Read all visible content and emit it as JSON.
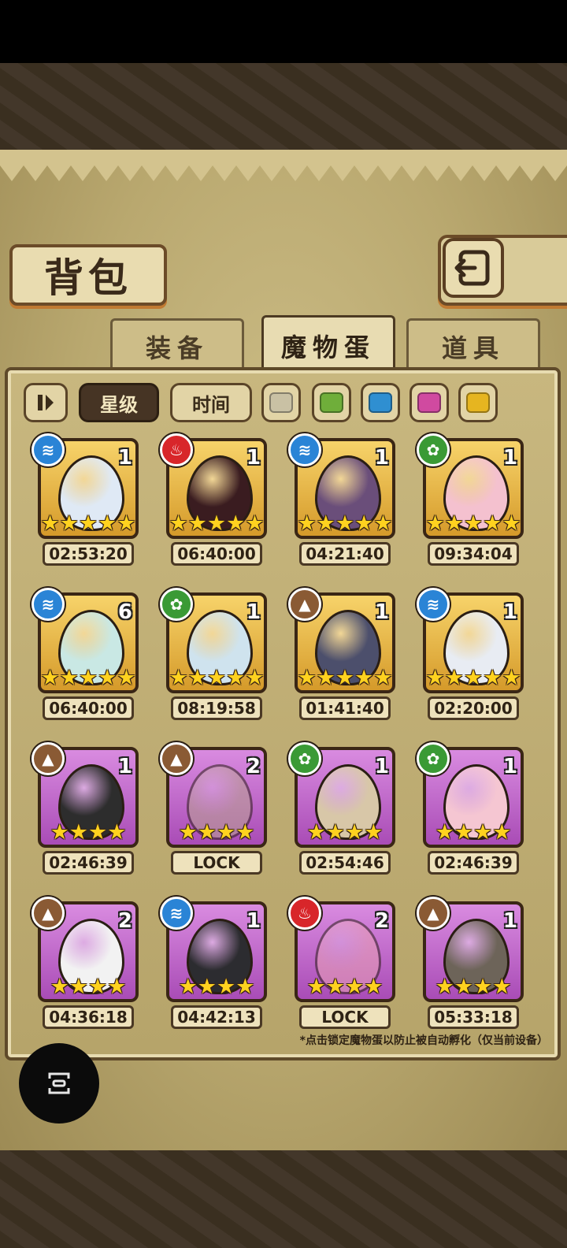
{
  "header": {
    "title": "背包"
  },
  "tabs": [
    {
      "label": "装备",
      "active": false
    },
    {
      "label": "魔物蛋",
      "active": true
    },
    {
      "label": "道具",
      "active": false
    }
  ],
  "filters": {
    "sort_icon": "sort-toggle-icon",
    "buttons": [
      {
        "label": "星级",
        "active": true
      },
      {
        "label": "时间",
        "active": false
      }
    ],
    "element_colors": [
      "#c9c1a4",
      "#6fae3a",
      "#2f8fd1",
      "#d04aa0",
      "#e6b520"
    ]
  },
  "elements": {
    "water": {
      "color": "#2a84d6",
      "glyph": "≋"
    },
    "fire": {
      "color": "#d8262a",
      "glyph": "♨"
    },
    "grass": {
      "color": "#3a9a35",
      "glyph": "✿"
    },
    "earth": {
      "color": "#8a5a34",
      "glyph": "▲"
    }
  },
  "eggs": [
    {
      "element": "water",
      "count": "1",
      "stars": 5,
      "rarity": "gold",
      "timer": "02:53:20",
      "egg_color": "#dfe9f5"
    },
    {
      "element": "fire",
      "count": "1",
      "stars": 5,
      "rarity": "gold",
      "timer": "06:40:00",
      "egg_color": "#3a1c20"
    },
    {
      "element": "water",
      "count": "1",
      "stars": 5,
      "rarity": "gold",
      "timer": "04:21:40",
      "egg_color": "#6a4e7a"
    },
    {
      "element": "grass",
      "count": "1",
      "stars": 5,
      "rarity": "gold",
      "timer": "09:34:04",
      "egg_color": "#f4c1cf"
    },
    {
      "element": "water",
      "count": "6",
      "stars": 5,
      "rarity": "gold",
      "timer": "06:40:00",
      "egg_color": "#c9e8e4"
    },
    {
      "element": "grass",
      "count": "1",
      "stars": 5,
      "rarity": "gold",
      "timer": "08:19:58",
      "egg_color": "#cfe3ee"
    },
    {
      "element": "earth",
      "count": "1",
      "stars": 5,
      "rarity": "gold",
      "timer": "01:41:40",
      "egg_color": "#4c4f6c"
    },
    {
      "element": "water",
      "count": "1",
      "stars": 5,
      "rarity": "gold",
      "timer": "02:20:00",
      "egg_color": "#e8ecf3"
    },
    {
      "element": "earth",
      "count": "1",
      "stars": 4,
      "rarity": "purple",
      "timer": "02:46:39",
      "egg_color": "#2d2d2d"
    },
    {
      "element": "earth",
      "count": "2",
      "stars": 4,
      "rarity": "purple",
      "timer": "LOCK",
      "egg_color": "#b9a48f",
      "locked": true
    },
    {
      "element": "grass",
      "count": "1",
      "stars": 4,
      "rarity": "purple",
      "timer": "02:54:46",
      "egg_color": "#d8c7a8"
    },
    {
      "element": "grass",
      "count": "1",
      "stars": 4,
      "rarity": "purple",
      "timer": "02:46:39",
      "egg_color": "#f5c6d2"
    },
    {
      "element": "earth",
      "count": "2",
      "stars": 4,
      "rarity": "purple",
      "timer": "04:36:18",
      "egg_color": "#f2f2f2"
    },
    {
      "element": "water",
      "count": "1",
      "stars": 4,
      "rarity": "purple",
      "timer": "04:42:13",
      "egg_color": "#2c2c30"
    },
    {
      "element": "fire",
      "count": "2",
      "stars": 4,
      "rarity": "purple",
      "timer": "LOCK",
      "egg_color": "#e9a3b4",
      "locked": true
    },
    {
      "element": "earth",
      "count": "1",
      "stars": 4,
      "rarity": "purple",
      "timer": "05:33:18",
      "egg_color": "#6d6459"
    }
  ],
  "footer_note": "*点击锁定魔物蛋以防止被自动孵化（仅当前设备）"
}
